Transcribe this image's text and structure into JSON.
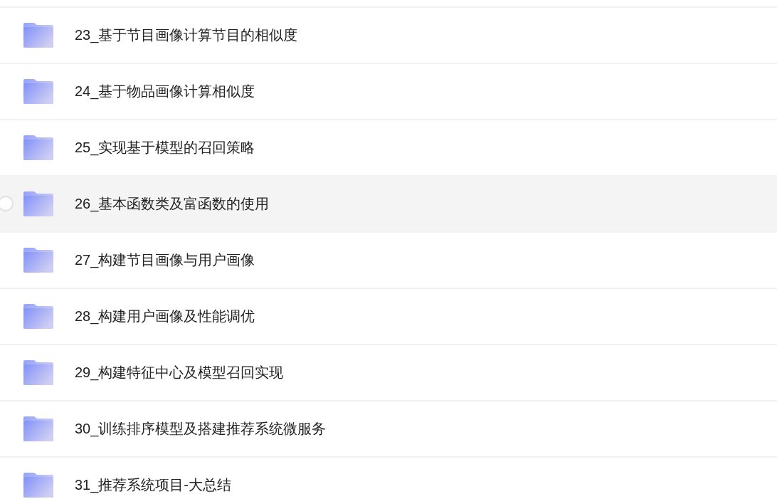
{
  "folders": [
    {
      "name": "23_基于节目画像计算节目的相似度",
      "hovered": false
    },
    {
      "name": "24_基于物品画像计算相似度",
      "hovered": false
    },
    {
      "name": "25_实现基于模型的召回策略",
      "hovered": false
    },
    {
      "name": "26_基本函数类及富函数的使用",
      "hovered": true
    },
    {
      "name": "27_构建节目画像与用户画像",
      "hovered": false
    },
    {
      "name": "28_构建用户画像及性能调优",
      "hovered": false
    },
    {
      "name": "29_构建特征中心及模型召回实现",
      "hovered": false
    },
    {
      "name": "30_训练排序模型及搭建推荐系统微服务",
      "hovered": false
    },
    {
      "name": "31_推荐系统项目-大总结",
      "hovered": false
    }
  ]
}
